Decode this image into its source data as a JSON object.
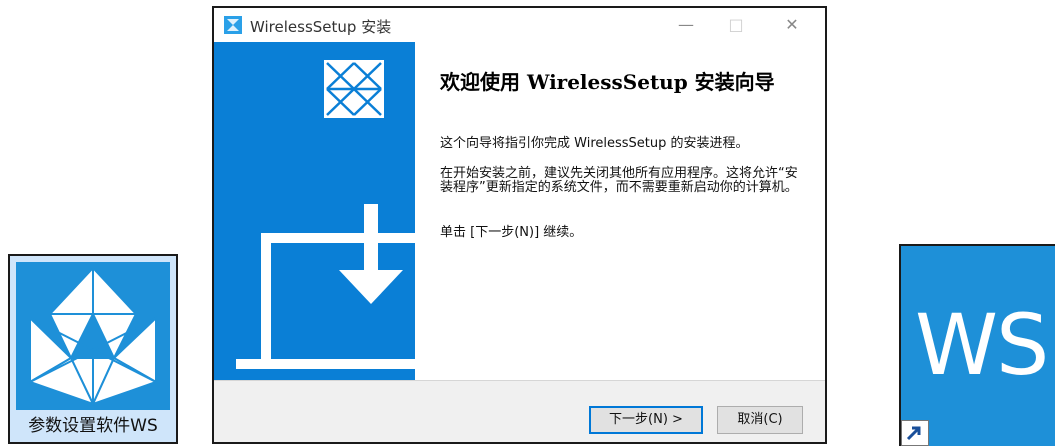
{
  "desktop": {
    "left_icon": {
      "label": "参数设置软件WS",
      "icon": "ws-setup-logo-icon"
    },
    "right_icon": {
      "label": "WS",
      "icon": "shortcut-arrow-icon"
    }
  },
  "window": {
    "title": "WirelessSetup 安装",
    "app_icon": "installer-app-icon",
    "controls": {
      "minimize": "—",
      "maximize": "□",
      "close": "✕"
    },
    "welcome_heading": "欢迎使用 WirelessSetup 安装向导",
    "paragraphs": [
      "这个向导将指引你完成 WirelessSetup 的安装进程。",
      "在开始安装之前，建议先关闭其他所有应用程序。这将允许“安装程序”更新指定的系统文件，而不需要重新启动你的计算机。",
      "单击 [下一步(N)] 继续。"
    ],
    "buttons": {
      "next": "下一步(N) >",
      "cancel": "取消(C)"
    }
  },
  "colors": {
    "accent_blue": "#0a7fd6",
    "icon_blue": "#1e90d8",
    "button_focus": "#0078d7"
  }
}
